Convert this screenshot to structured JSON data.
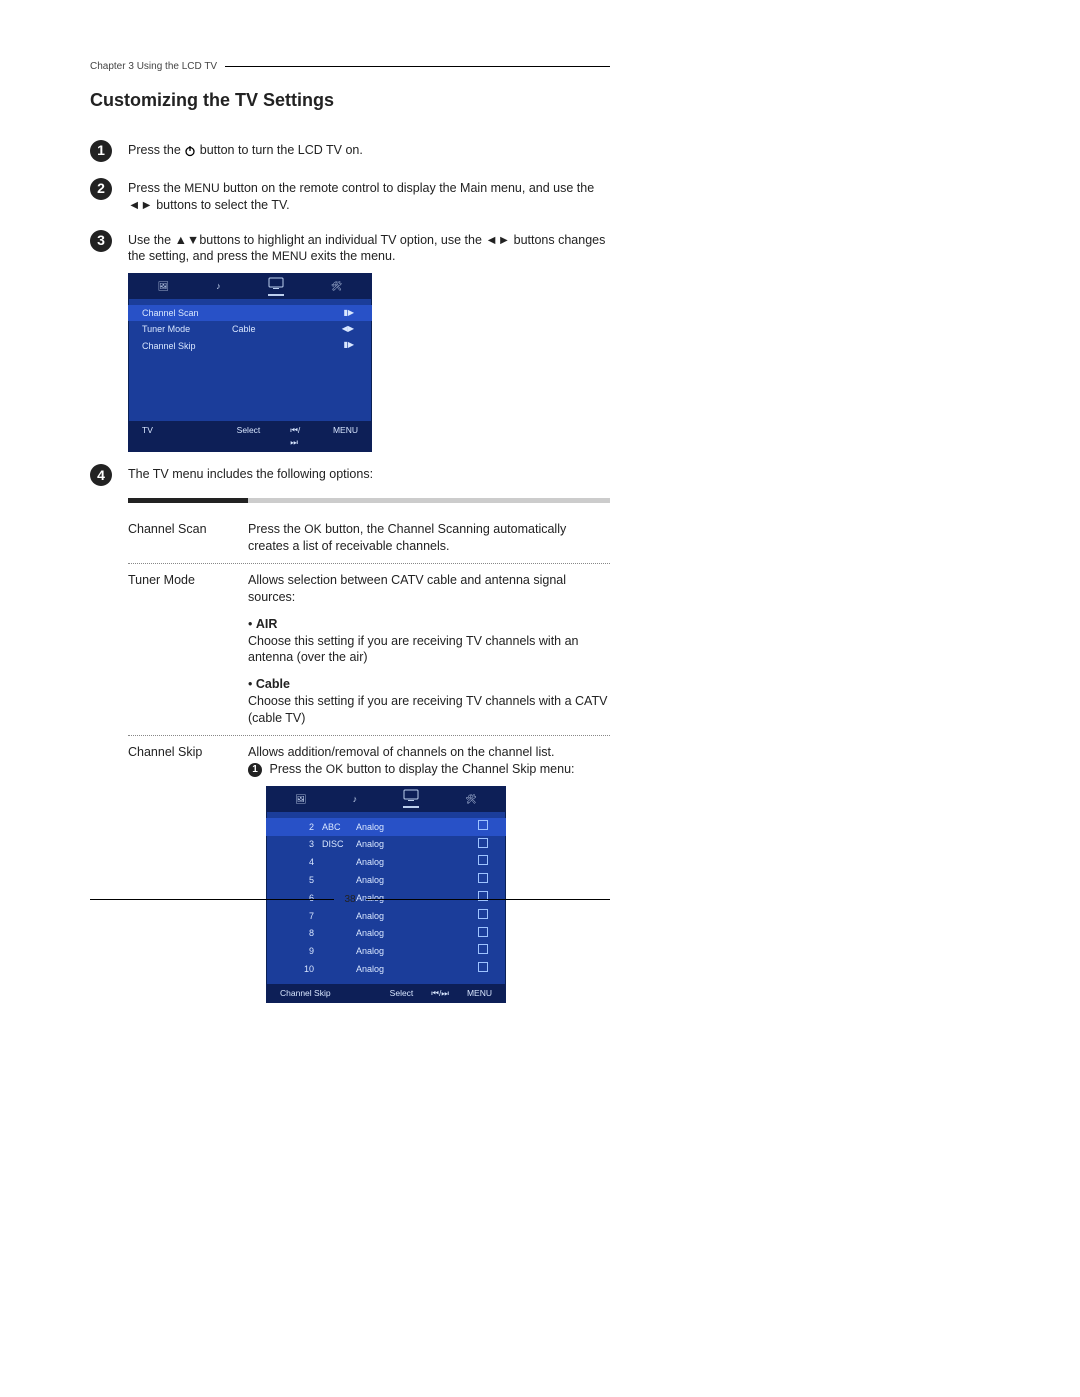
{
  "chapter": "Chapter 3 Using the LCD TV",
  "section_title": "Customizing the TV Settings",
  "page_number": "38",
  "steps": {
    "s1": {
      "num": "1",
      "text_a": "Press the ",
      "text_b": " button to turn the LCD TV on."
    },
    "s2": {
      "num": "2",
      "text_a": "Press the ",
      "menu": "MENU",
      "text_b": " button on the remote control to display the Main menu, and use the ",
      "text_c": " buttons to select the TV."
    },
    "s3": {
      "num": "3",
      "text_a": "Use the ",
      "text_b": "buttons to highlight an individual TV option, use the ",
      "text_c": " buttons changes the setting, and press the ",
      "menu": "MENU",
      "text_d": " exits the menu."
    },
    "s4": {
      "num": "4",
      "text": "The TV menu includes the following options:"
    }
  },
  "osd1": {
    "rows": [
      {
        "label": "Channel Scan",
        "val": "",
        "ctrl": "▮▶"
      },
      {
        "label": "Tuner Mode",
        "val": "Cable",
        "ctrl": "◀▶"
      },
      {
        "label": "Channel Skip",
        "val": "",
        "ctrl": "▮▶"
      }
    ],
    "foot": {
      "f1": "TV",
      "f2": "Select",
      "f3": "⏮/⏭",
      "f4": "MENU"
    }
  },
  "options": {
    "channel_scan": {
      "label": "Channel Scan",
      "desc_a": "Press the ",
      "ok": "OK",
      "desc_b": " button, the Channel Scanning automatically creates a list of receivable channels."
    },
    "tuner_mode": {
      "label": "Tuner Mode",
      "desc": "Allows selection between CATV cable and antenna signal sources:",
      "air_title": "AIR",
      "air_desc": "Choose this setting if you are receiving TV channels with an antenna (over the air)",
      "cable_title": "Cable",
      "cable_desc": "Choose this setting if you are receiving TV channels with a CATV (cable TV)"
    },
    "channel_skip": {
      "label": "Channel Skip",
      "desc": "Allows addition/removal of channels on the channel list.",
      "sub_num": "1",
      "sub_a": "Press the ",
      "ok": "OK",
      "sub_b": " button to display the Channel Skip menu:"
    }
  },
  "osd2": {
    "rows": [
      {
        "n": "2",
        "name": "ABC",
        "type": "Analog"
      },
      {
        "n": "3",
        "name": "DISC",
        "type": "Analog"
      },
      {
        "n": "4",
        "name": "",
        "type": "Analog"
      },
      {
        "n": "5",
        "name": "",
        "type": "Analog"
      },
      {
        "n": "6",
        "name": "",
        "type": "Analog"
      },
      {
        "n": "7",
        "name": "",
        "type": "Analog"
      },
      {
        "n": "8",
        "name": "",
        "type": "Analog"
      },
      {
        "n": "9",
        "name": "",
        "type": "Analog"
      },
      {
        "n": "10",
        "name": "",
        "type": "Analog"
      }
    ],
    "foot": {
      "f1": "Channel Skip",
      "f2": "Select",
      "f3": "⏮/⏭",
      "f4": "MENU"
    }
  }
}
